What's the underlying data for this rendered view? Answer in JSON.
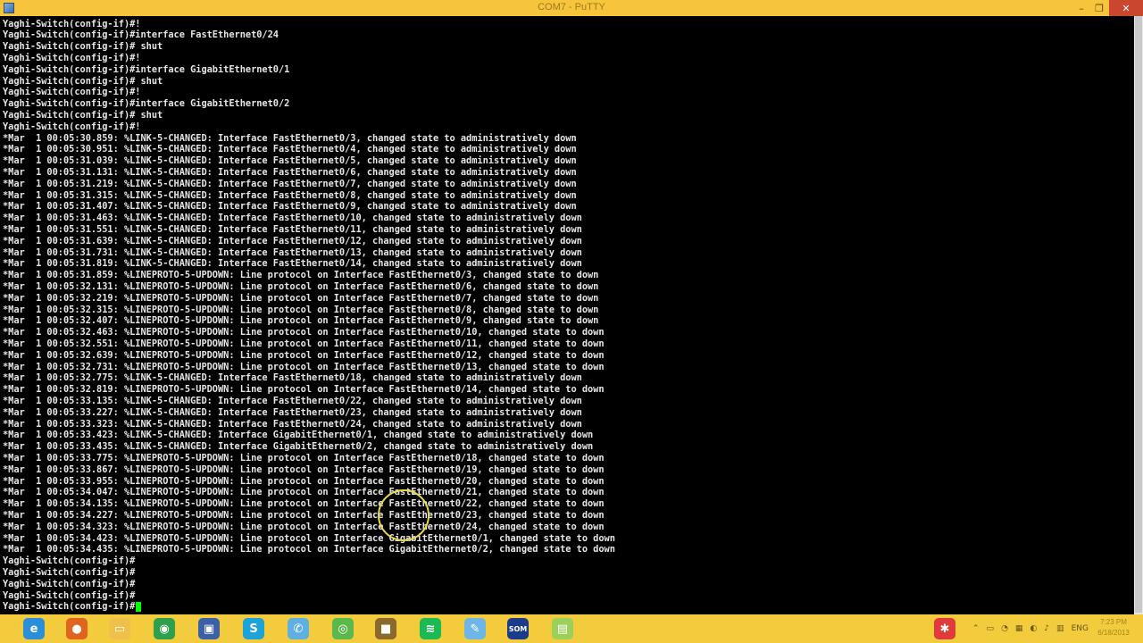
{
  "window": {
    "title": "COM7 - PuTTY",
    "min_label": "–",
    "max_label": "❐",
    "close_label": "✕"
  },
  "terminal_lines": [
    "Yaghi-Switch(config-if)#!",
    "Yaghi-Switch(config-if)#interface FastEthernet0/24",
    "Yaghi-Switch(config-if)# shut",
    "Yaghi-Switch(config-if)#!",
    "Yaghi-Switch(config-if)#interface GigabitEthernet0/1",
    "Yaghi-Switch(config-if)# shut",
    "Yaghi-Switch(config-if)#!",
    "Yaghi-Switch(config-if)#interface GigabitEthernet0/2",
    "Yaghi-Switch(config-if)# shut",
    "Yaghi-Switch(config-if)#!",
    "*Mar  1 00:05:30.859: %LINK-5-CHANGED: Interface FastEthernet0/3, changed state to administratively down",
    "*Mar  1 00:05:30.951: %LINK-5-CHANGED: Interface FastEthernet0/4, changed state to administratively down",
    "*Mar  1 00:05:31.039: %LINK-5-CHANGED: Interface FastEthernet0/5, changed state to administratively down",
    "*Mar  1 00:05:31.131: %LINK-5-CHANGED: Interface FastEthernet0/6, changed state to administratively down",
    "*Mar  1 00:05:31.219: %LINK-5-CHANGED: Interface FastEthernet0/7, changed state to administratively down",
    "*Mar  1 00:05:31.315: %LINK-5-CHANGED: Interface FastEthernet0/8, changed state to administratively down",
    "*Mar  1 00:05:31.407: %LINK-5-CHANGED: Interface FastEthernet0/9, changed state to administratively down",
    "*Mar  1 00:05:31.463: %LINK-5-CHANGED: Interface FastEthernet0/10, changed state to administratively down",
    "*Mar  1 00:05:31.551: %LINK-5-CHANGED: Interface FastEthernet0/11, changed state to administratively down",
    "*Mar  1 00:05:31.639: %LINK-5-CHANGED: Interface FastEthernet0/12, changed state to administratively down",
    "*Mar  1 00:05:31.731: %LINK-5-CHANGED: Interface FastEthernet0/13, changed state to administratively down",
    "*Mar  1 00:05:31.819: %LINK-5-CHANGED: Interface FastEthernet0/14, changed state to administratively down",
    "*Mar  1 00:05:31.859: %LINEPROTO-5-UPDOWN: Line protocol on Interface FastEthernet0/3, changed state to down",
    "*Mar  1 00:05:32.131: %LINEPROTO-5-UPDOWN: Line protocol on Interface FastEthernet0/6, changed state to down",
    "*Mar  1 00:05:32.219: %LINEPROTO-5-UPDOWN: Line protocol on Interface FastEthernet0/7, changed state to down",
    "*Mar  1 00:05:32.315: %LINEPROTO-5-UPDOWN: Line protocol on Interface FastEthernet0/8, changed state to down",
    "*Mar  1 00:05:32.407: %LINEPROTO-5-UPDOWN: Line protocol on Interface FastEthernet0/9, changed state to down",
    "*Mar  1 00:05:32.463: %LINEPROTO-5-UPDOWN: Line protocol on Interface FastEthernet0/10, changed state to down",
    "*Mar  1 00:05:32.551: %LINEPROTO-5-UPDOWN: Line protocol on Interface FastEthernet0/11, changed state to down",
    "*Mar  1 00:05:32.639: %LINEPROTO-5-UPDOWN: Line protocol on Interface FastEthernet0/12, changed state to down",
    "*Mar  1 00:05:32.731: %LINEPROTO-5-UPDOWN: Line protocol on Interface FastEthernet0/13, changed state to down",
    "*Mar  1 00:05:32.775: %LINK-5-CHANGED: Interface FastEthernet0/18, changed state to administratively down",
    "*Mar  1 00:05:32.819: %LINEPROTO-5-UPDOWN: Line protocol on Interface FastEthernet0/14, changed state to down",
    "*Mar  1 00:05:33.135: %LINK-5-CHANGED: Interface FastEthernet0/22, changed state to administratively down",
    "*Mar  1 00:05:33.227: %LINK-5-CHANGED: Interface FastEthernet0/23, changed state to administratively down",
    "*Mar  1 00:05:33.323: %LINK-5-CHANGED: Interface FastEthernet0/24, changed state to administratively down",
    "*Mar  1 00:05:33.423: %LINK-5-CHANGED: Interface GigabitEthernet0/1, changed state to administratively down",
    "*Mar  1 00:05:33.435: %LINK-5-CHANGED: Interface GigabitEthernet0/2, changed state to administratively down",
    "*Mar  1 00:05:33.775: %LINEPROTO-5-UPDOWN: Line protocol on Interface FastEthernet0/18, changed state to down",
    "*Mar  1 00:05:33.867: %LINEPROTO-5-UPDOWN: Line protocol on Interface FastEthernet0/19, changed state to down",
    "*Mar  1 00:05:33.955: %LINEPROTO-5-UPDOWN: Line protocol on Interface FastEthernet0/20, changed state to down",
    "*Mar  1 00:05:34.047: %LINEPROTO-5-UPDOWN: Line protocol on Interface FastEthernet0/21, changed state to down",
    "*Mar  1 00:05:34.135: %LINEPROTO-5-UPDOWN: Line protocol on Interface FastEthernet0/22, changed state to down",
    "*Mar  1 00:05:34.227: %LINEPROTO-5-UPDOWN: Line protocol on Interface FastEthernet0/23, changed state to down",
    "*Mar  1 00:05:34.323: %LINEPROTO-5-UPDOWN: Line protocol on Interface FastEthernet0/24, changed state to down",
    "*Mar  1 00:05:34.423: %LINEPROTO-5-UPDOWN: Line protocol on Interface GigabitEthernet0/1, changed state to down",
    "*Mar  1 00:05:34.435: %LINEPROTO-5-UPDOWN: Line protocol on Interface GigabitEthernet0/2, changed state to down",
    "Yaghi-Switch(config-if)#",
    "Yaghi-Switch(config-if)#",
    "Yaghi-Switch(config-if)#",
    "Yaghi-Switch(config-if)#",
    "Yaghi-Switch(config-if)#"
  ],
  "taskbar": {
    "apps": [
      {
        "name": "ie-icon",
        "glyph": "e",
        "color": "#2a8fd8"
      },
      {
        "name": "firefox-icon",
        "glyph": "●",
        "color": "#e0641e"
      },
      {
        "name": "file-explorer-icon",
        "glyph": "▭",
        "color": "#f0c14a"
      },
      {
        "name": "chrome-icon",
        "glyph": "◉",
        "color": "#2e9f4a"
      },
      {
        "name": "network-tool-icon",
        "glyph": "▣",
        "color": "#3c5fa8"
      },
      {
        "name": "skype-icon",
        "glyph": "S",
        "color": "#1ea3d8"
      },
      {
        "name": "phone-icon",
        "glyph": "✆",
        "color": "#5fb0e0"
      },
      {
        "name": "camtasia-icon",
        "glyph": "◎",
        "color": "#5bb84a"
      },
      {
        "name": "package-icon",
        "glyph": "■",
        "color": "#8a6a2a"
      },
      {
        "name": "spotify-icon",
        "glyph": "≋",
        "color": "#1db954"
      },
      {
        "name": "paint-icon",
        "glyph": "✎",
        "color": "#6fb6e6"
      },
      {
        "name": "som-icon",
        "glyph": "SOM",
        "color": "#1a3c8a"
      },
      {
        "name": "notepad-icon",
        "glyph": "▤",
        "color": "#9bd05a"
      }
    ],
    "tray_app": {
      "name": "tray-app-icon",
      "glyph": "✱",
      "color": "#e03a3a"
    },
    "tray_icons": [
      "⌃",
      "▭",
      "◔",
      "▦",
      "◐",
      "♪",
      "▥"
    ],
    "language": "ENG",
    "time": "7:23 PM",
    "date": "6/18/2013"
  }
}
